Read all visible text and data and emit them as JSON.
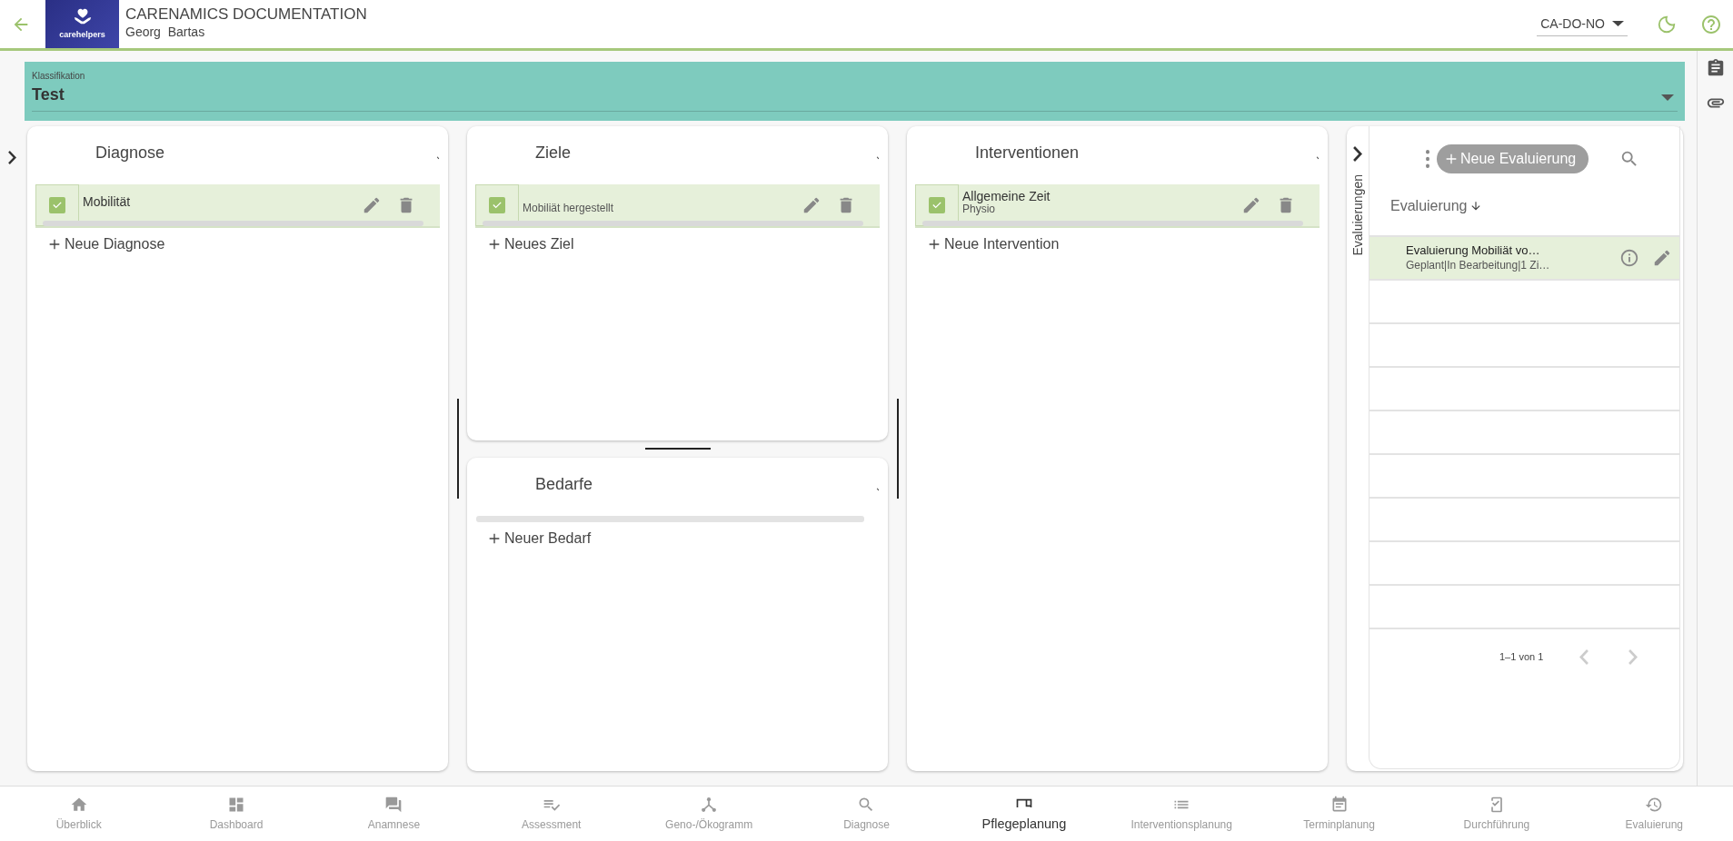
{
  "header": {
    "logo_text": "carehelpers",
    "title": "CARENAMICS DOCUMENTATION",
    "user": "Georg  Bartas",
    "org_select": {
      "value": "CA-DO-NO"
    }
  },
  "classification": {
    "label": "Klassifikation",
    "value": "Test"
  },
  "columns": [
    {
      "panels": [
        {
          "title": "Diagnose",
          "items": [
            {
              "title": "Mobilität",
              "checked": true,
              "selected": true
            }
          ],
          "add_label": "Neue Diagnose"
        }
      ]
    },
    {
      "panels": [
        {
          "title": "Ziele",
          "items": [
            {
              "subtitle": "Mobiliät hergestellt",
              "checked": true,
              "selected": true
            }
          ],
          "add_label": "Neues Ziel"
        },
        {
          "title": "Bedarfe",
          "add_label": "Neuer Bedarf"
        }
      ]
    },
    {
      "panels": [
        {
          "title": "Interventionen",
          "items": [
            {
              "title": "Allgemeine Zeit",
              "subtitle": "Physio",
              "checked": true,
              "selected": true
            }
          ],
          "add_label": "Neue Intervention"
        }
      ]
    }
  ],
  "evaluations": {
    "side_label": "Evaluierungen",
    "new_button": "Neue Evaluierung",
    "column_header": "Evaluierung",
    "rows": [
      {
        "title": "Evaluierung Mobiliät vo…",
        "subtitle": "Geplant|In Bearbeitung|1 Zi…",
        "selected": true
      }
    ],
    "pagination": "1–1 von 1"
  },
  "bottom_nav": [
    {
      "label": "Überblick",
      "selected": false
    },
    {
      "label": "Dashboard",
      "selected": false
    },
    {
      "label": "Anamnese",
      "selected": false
    },
    {
      "label": "Assessment",
      "selected": false
    },
    {
      "label": "Geno-/Ökogramm",
      "selected": false
    },
    {
      "label": "Diagnose",
      "selected": false
    },
    {
      "label": "Pflegeplanung",
      "selected": true
    },
    {
      "label": "Interventionsplanung",
      "selected": false
    },
    {
      "label": "Terminplanung",
      "selected": false
    },
    {
      "label": "Durchführung",
      "selected": false
    },
    {
      "label": "Evaluierung",
      "selected": false
    }
  ]
}
